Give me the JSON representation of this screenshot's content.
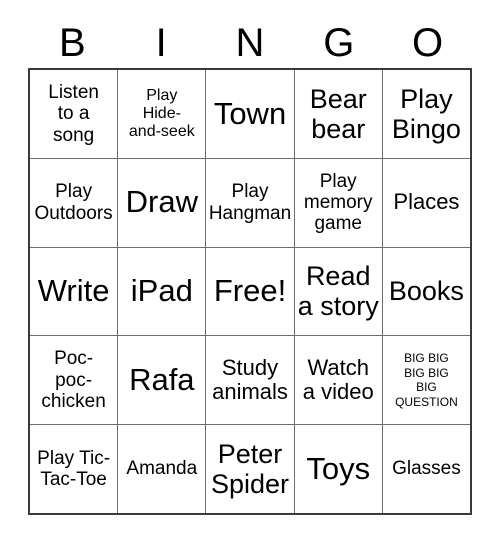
{
  "card": {
    "headers": [
      "B",
      "I",
      "N",
      "G",
      "O"
    ],
    "rows": [
      [
        {
          "text": "Listen\nto a\nsong",
          "size": "md"
        },
        {
          "text": "Play\nHide-\nand-seek",
          "size": "sm"
        },
        {
          "text": "Town",
          "size": "xxl"
        },
        {
          "text": "Bear\nbear",
          "size": "xl"
        },
        {
          "text": "Play\nBingo",
          "size": "xl"
        }
      ],
      [
        {
          "text": "Play\nOutdoors",
          "size": "md"
        },
        {
          "text": "Draw",
          "size": "xxl"
        },
        {
          "text": "Play\nHangman",
          "size": "md"
        },
        {
          "text": "Play\nmemory\ngame",
          "size": "md"
        },
        {
          "text": "Places",
          "size": "lg"
        }
      ],
      [
        {
          "text": "Write",
          "size": "xxl"
        },
        {
          "text": "iPad",
          "size": "xxl"
        },
        {
          "text": "Free!",
          "size": "xxl"
        },
        {
          "text": "Read\na story",
          "size": "xl"
        },
        {
          "text": "Books",
          "size": "xl"
        }
      ],
      [
        {
          "text": "Poc-\npoc-\nchicken",
          "size": "md"
        },
        {
          "text": "Rafa",
          "size": "xxl"
        },
        {
          "text": "Study\nanimals",
          "size": "lg"
        },
        {
          "text": "Watch\na video",
          "size": "lg"
        },
        {
          "text": "BIG BIG\nBIG BIG\nBIG\nQUESTION",
          "size": "xs"
        }
      ],
      [
        {
          "text": "Play Tic-\nTac-Toe",
          "size": "md"
        },
        {
          "text": "Amanda",
          "size": "md"
        },
        {
          "text": "Peter\nSpider",
          "size": "xl"
        },
        {
          "text": "Toys",
          "size": "xxl"
        },
        {
          "text": "Glasses",
          "size": "md"
        }
      ]
    ]
  },
  "colors": {
    "background": "#ffffff",
    "text": "#000000",
    "grid_line": "#6d6d6d",
    "grid_border": "#3a3a3a"
  }
}
